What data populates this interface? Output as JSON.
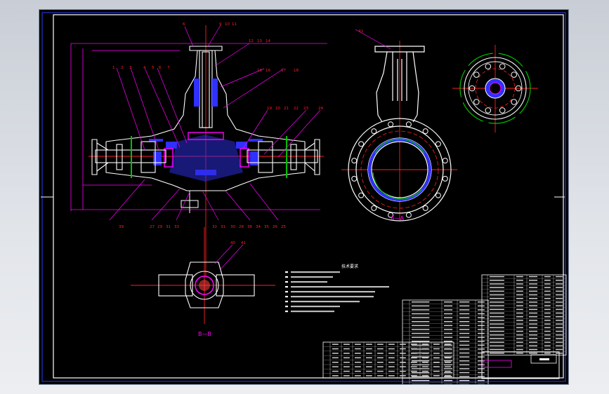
{
  "balloons": {
    "top": [
      "6",
      "9",
      "10",
      "11",
      "12",
      "13",
      "14",
      "15",
      "16",
      "17",
      "18"
    ],
    "left": [
      "1",
      "2",
      "3",
      "4",
      "5",
      "6",
      "7"
    ],
    "right": [
      "19",
      "20",
      "21",
      "22",
      "23",
      "24"
    ],
    "bottom": [
      "39",
      "27",
      "29",
      "31",
      "33",
      "32",
      "31",
      "30",
      "28",
      "36",
      "34",
      "35",
      "26",
      "25"
    ],
    "view_bb": [
      "40",
      "41"
    ],
    "side": [
      "41"
    ]
  },
  "section_labels": {
    "aa": "A—A",
    "bb": "B—B"
  },
  "notes_title": "技术要求",
  "colors": {
    "paper": "#000000",
    "outline": "#ffffff",
    "dimension": "#ff00ff",
    "center": "#ff2020",
    "hidden": "#00c000",
    "hatch": "#3030ff",
    "frame": "#2a3cff"
  }
}
